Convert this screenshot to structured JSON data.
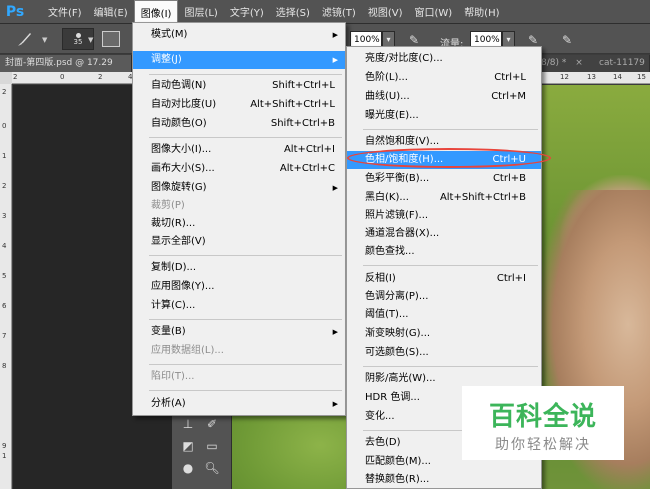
{
  "menubar": {
    "logo": "Ps",
    "items": [
      {
        "label": "文件(F)"
      },
      {
        "label": "编辑(E)"
      },
      {
        "label": "图像(I)",
        "active": true
      },
      {
        "label": "图层(L)"
      },
      {
        "label": "文字(Y)"
      },
      {
        "label": "选择(S)"
      },
      {
        "label": "滤镜(T)"
      },
      {
        "label": "视图(V)"
      },
      {
        "label": "窗口(W)"
      },
      {
        "label": "帮助(H)"
      }
    ]
  },
  "options": {
    "brush_size": "35",
    "opacity_value": "100%",
    "flow_label": "流量:",
    "flow_value": "100%"
  },
  "tabs": {
    "left_tab": "封面-第四版.psd @ 17.29",
    "right_partial": "8/8) *",
    "close_char": "×",
    "right_tab": "cat-11179"
  },
  "rulers": {
    "h_labels": [
      "2",
      "0",
      "2",
      "4",
      "12",
      "13",
      "14",
      "15"
    ],
    "v_labels": [
      "2",
      "0",
      "1",
      "2",
      "3",
      "4",
      "5",
      "6",
      "7",
      "8",
      "9",
      "1",
      "0"
    ]
  },
  "image_menu": {
    "items": [
      {
        "label": "模式(M)",
        "submenu": true
      },
      {
        "label": "调整(J)",
        "submenu": true,
        "highlighted": true
      },
      {
        "label": "自动色调(N)",
        "shortcut": "Shift+Ctrl+L"
      },
      {
        "label": "自动对比度(U)",
        "shortcut": "Alt+Shift+Ctrl+L"
      },
      {
        "label": "自动颜色(O)",
        "shortcut": "Shift+Ctrl+B"
      },
      {
        "label": "图像大小(I)...",
        "shortcut": "Alt+Ctrl+I"
      },
      {
        "label": "画布大小(S)...",
        "shortcut": "Alt+Ctrl+C"
      },
      {
        "label": "图像旋转(G)",
        "submenu": true
      },
      {
        "label": "裁剪(P)",
        "disabled": true
      },
      {
        "label": "裁切(R)..."
      },
      {
        "label": "显示全部(V)"
      },
      {
        "label": "复制(D)..."
      },
      {
        "label": "应用图像(Y)..."
      },
      {
        "label": "计算(C)..."
      },
      {
        "label": "变量(B)",
        "submenu": true
      },
      {
        "label": "应用数据组(L)...",
        "disabled": true
      },
      {
        "label": "陷印(T)...",
        "disabled": true
      },
      {
        "label": "分析(A)",
        "submenu": true
      }
    ]
  },
  "adjust_menu": {
    "items": [
      {
        "label": "亮度/对比度(C)..."
      },
      {
        "label": "色阶(L)...",
        "shortcut": "Ctrl+L"
      },
      {
        "label": "曲线(U)...",
        "shortcut": "Ctrl+M"
      },
      {
        "label": "曝光度(E)..."
      },
      {
        "label": "自然饱和度(V)..."
      },
      {
        "label": "色相/饱和度(H)...",
        "shortcut": "Ctrl+U",
        "highlighted": true
      },
      {
        "label": "色彩平衡(B)...",
        "shortcut": "Ctrl+B"
      },
      {
        "label": "黑白(K)...",
        "shortcut": "Alt+Shift+Ctrl+B"
      },
      {
        "label": "照片滤镜(F)..."
      },
      {
        "label": "通道混合器(X)..."
      },
      {
        "label": "颜色查找..."
      },
      {
        "label": "反相(I)",
        "shortcut": "Ctrl+I"
      },
      {
        "label": "色调分离(P)..."
      },
      {
        "label": "阈值(T)..."
      },
      {
        "label": "渐变映射(G)..."
      },
      {
        "label": "可选颜色(S)..."
      },
      {
        "label": "阴影/高光(W)..."
      },
      {
        "label": "HDR 色调..."
      },
      {
        "label": "变化..."
      },
      {
        "label": "去色(D)"
      },
      {
        "label": "匹配颜色(M)..."
      },
      {
        "label": "替换颜色(R)..."
      }
    ]
  },
  "watermark": {
    "title": "百科全说",
    "subtitle": "助你轻松解决"
  },
  "colors": {
    "highlight": "#3399ff",
    "annotation_ellipse": "#e8453c",
    "watermark_green": "#3cb55a"
  }
}
